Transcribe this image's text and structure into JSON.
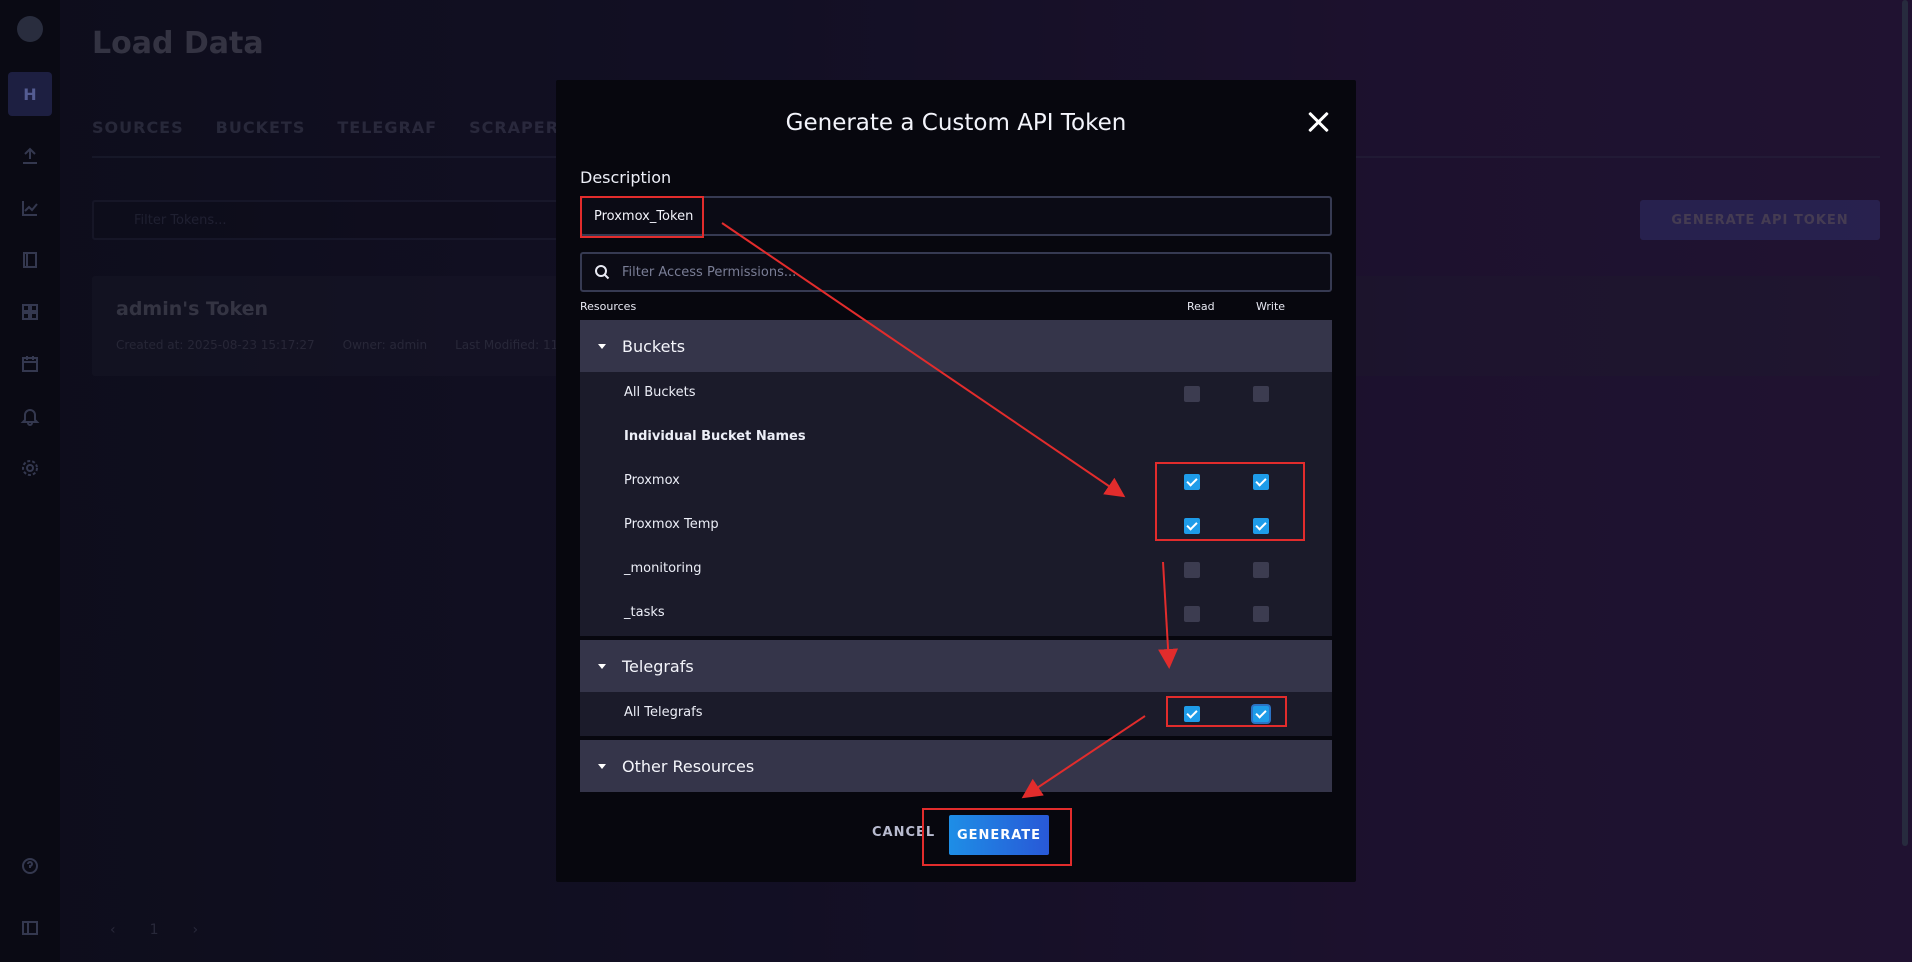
{
  "nav": {
    "org_initial": "H",
    "icons": [
      "logo-icon",
      "upload-icon",
      "graph-icon",
      "notebook-icon",
      "dashboard-icon",
      "calendar-icon",
      "bell-icon",
      "gear-icon",
      "help-icon",
      "collapse-icon"
    ]
  },
  "page": {
    "title": "Load Data",
    "tabs": [
      "SOURCES",
      "BUCKETS",
      "TELEGRAF",
      "SCRAPERS"
    ],
    "filter_placeholder": "Filter Tokens...",
    "generate_button": "GENERATE API TOKEN",
    "token": {
      "name": "admin's Token",
      "created": "Created at: 2025-08-23 15:17:27",
      "owner": "Owner: admin",
      "modified": "Last Modified: 11"
    },
    "pager": {
      "prev": "‹",
      "current": "1",
      "next": "›"
    }
  },
  "dialog": {
    "title": "Generate a Custom API Token",
    "description_label": "Description",
    "description_value": "Proxmox_Token",
    "filter_placeholder": "Filter Access Permissions...",
    "columns": {
      "resources": "Resources",
      "read": "Read",
      "write": "Write"
    },
    "sections": {
      "buckets": {
        "title": "Buckets",
        "all_label": "All Buckets",
        "all_read": false,
        "all_write": false,
        "individual_heading": "Individual Bucket Names",
        "items": [
          {
            "label": "Proxmox",
            "read": true,
            "write": true
          },
          {
            "label": "Proxmox Temp",
            "read": true,
            "write": true
          },
          {
            "label": "_monitoring",
            "read": false,
            "write": false
          },
          {
            "label": "_tasks",
            "read": false,
            "write": false
          }
        ]
      },
      "telegrafs": {
        "title": "Telegrafs",
        "all_label": "All Telegrafs",
        "all_read": true,
        "all_write": true
      },
      "other": {
        "title": "Other Resources"
      }
    },
    "cancel_label": "CANCEL",
    "generate_label": "GENERATE"
  },
  "colors": {
    "accent_blue": "#1e9ce9",
    "annotation_red": "#e22c2c",
    "dialog_bg": "#07070e"
  }
}
